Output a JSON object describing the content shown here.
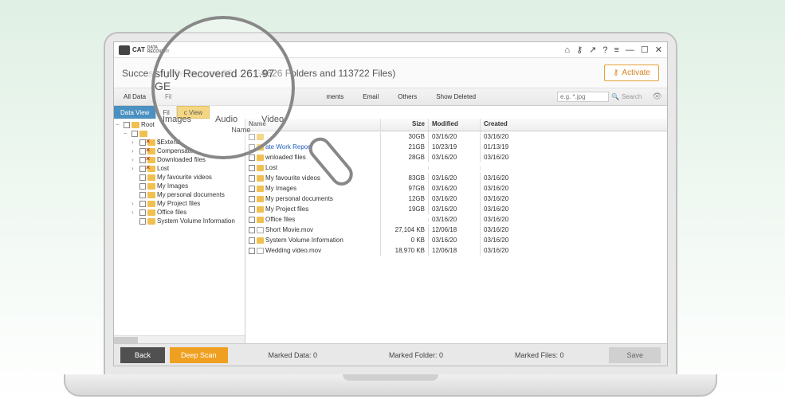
{
  "brand": {
    "name": "CAT",
    "tag1": "DATA",
    "tag2": "RECOVERY"
  },
  "toolbar_icons": {
    "home": "⌂",
    "key": "⚷",
    "share": "↗",
    "help": "?",
    "menu": "≡",
    "min": "—",
    "max": "☐",
    "close": "✕"
  },
  "status": {
    "prefix": "Succe",
    "text": "sfully Recovered 261.97 G",
    "suffix": "4626 Folders and 113722 Files)",
    "activate": "Activate"
  },
  "filters": {
    "all": "All Data",
    "files": "Fil",
    "docs": "ments",
    "email": "Email",
    "others": "Others",
    "deleted": "Show Deleted",
    "placeholder": "e.g. *.jpg",
    "search": "Search"
  },
  "views": {
    "data": "Data View",
    "file": "Fil",
    "classic": "c View"
  },
  "tree": [
    {
      "d": 0,
      "exp": "−",
      "label": "Root",
      "x": false
    },
    {
      "d": 1,
      "exp": "−",
      "label": "",
      "x": false
    },
    {
      "d": 2,
      "exp": "›",
      "label": "$Extend",
      "x": true
    },
    {
      "d": 2,
      "exp": "›",
      "label": "Compensate",
      "x": true
    },
    {
      "d": 2,
      "exp": "›",
      "label": "Downloaded files",
      "x": true
    },
    {
      "d": 2,
      "exp": "›",
      "label": "Lost",
      "x": true
    },
    {
      "d": 2,
      "exp": "",
      "label": "My favourite videos",
      "x": false
    },
    {
      "d": 2,
      "exp": "",
      "label": "My Images",
      "x": false
    },
    {
      "d": 2,
      "exp": "",
      "label": "My personal documents",
      "x": false
    },
    {
      "d": 2,
      "exp": "›",
      "label": "My Project files",
      "x": false
    },
    {
      "d": 2,
      "exp": "›",
      "label": "Office files",
      "x": false
    },
    {
      "d": 2,
      "exp": "",
      "label": "System Volume Information",
      "x": false
    }
  ],
  "cols": {
    "name": "Name",
    "size": "Size",
    "mod": "Modified",
    "cre": "Created"
  },
  "rows": [
    {
      "name": "",
      "icon": "fld",
      "size": "30GB",
      "mod": "03/16/20",
      "cre": "03/16/20"
    },
    {
      "name": "ate Work Report…",
      "icon": "fld",
      "blue": true,
      "size": "21GB",
      "mod": "10/23/19",
      "cre": "01/13/19"
    },
    {
      "name": "wnloaded files",
      "icon": "fld",
      "size": "28GB",
      "mod": "03/16/20",
      "cre": "03/16/20"
    },
    {
      "name": "Lost",
      "icon": "fld",
      "size": "",
      "mod": "",
      "cre": ""
    },
    {
      "name": "My favourite videos",
      "icon": "fld",
      "size": "83GB",
      "mod": "03/16/20",
      "cre": "03/16/20"
    },
    {
      "name": "My Images",
      "icon": "fld",
      "size": "97GB",
      "mod": "03/16/20",
      "cre": "03/16/20"
    },
    {
      "name": "My personal documents",
      "icon": "fld",
      "size": "12GB",
      "mod": "03/16/20",
      "cre": "03/16/20"
    },
    {
      "name": "My Project files",
      "icon": "fld",
      "size": "19GB",
      "mod": "03/16/20",
      "cre": "03/16/20"
    },
    {
      "name": "Office files",
      "icon": "fld",
      "size": "",
      "mod": "03/16/20",
      "cre": "03/16/20"
    },
    {
      "name": "Short Movie.mov",
      "icon": "file",
      "size": "27,104 KB",
      "mod": "12/06/18",
      "cre": "03/16/20"
    },
    {
      "name": "System Volume Information",
      "icon": "fld",
      "size": "0 KB",
      "mod": "03/16/20",
      "cre": "03/16/20"
    },
    {
      "name": "Wedding video.mov",
      "icon": "file",
      "size": "18,970 KB",
      "mod": "12/06/18",
      "cre": "03/16/20"
    }
  ],
  "footer": {
    "back": "Back",
    "deep": "Deep Scan",
    "marked_data": "Marked Data:  0",
    "marked_folder": "Marked Folder:  0",
    "marked_files": "Marked Files:  0",
    "save": "Save"
  },
  "lens": {
    "main": "sfully Recovered 261.97 GE",
    "t1": "Images",
    "t2": "Audio",
    "t3": "Video",
    "name": "Name"
  }
}
